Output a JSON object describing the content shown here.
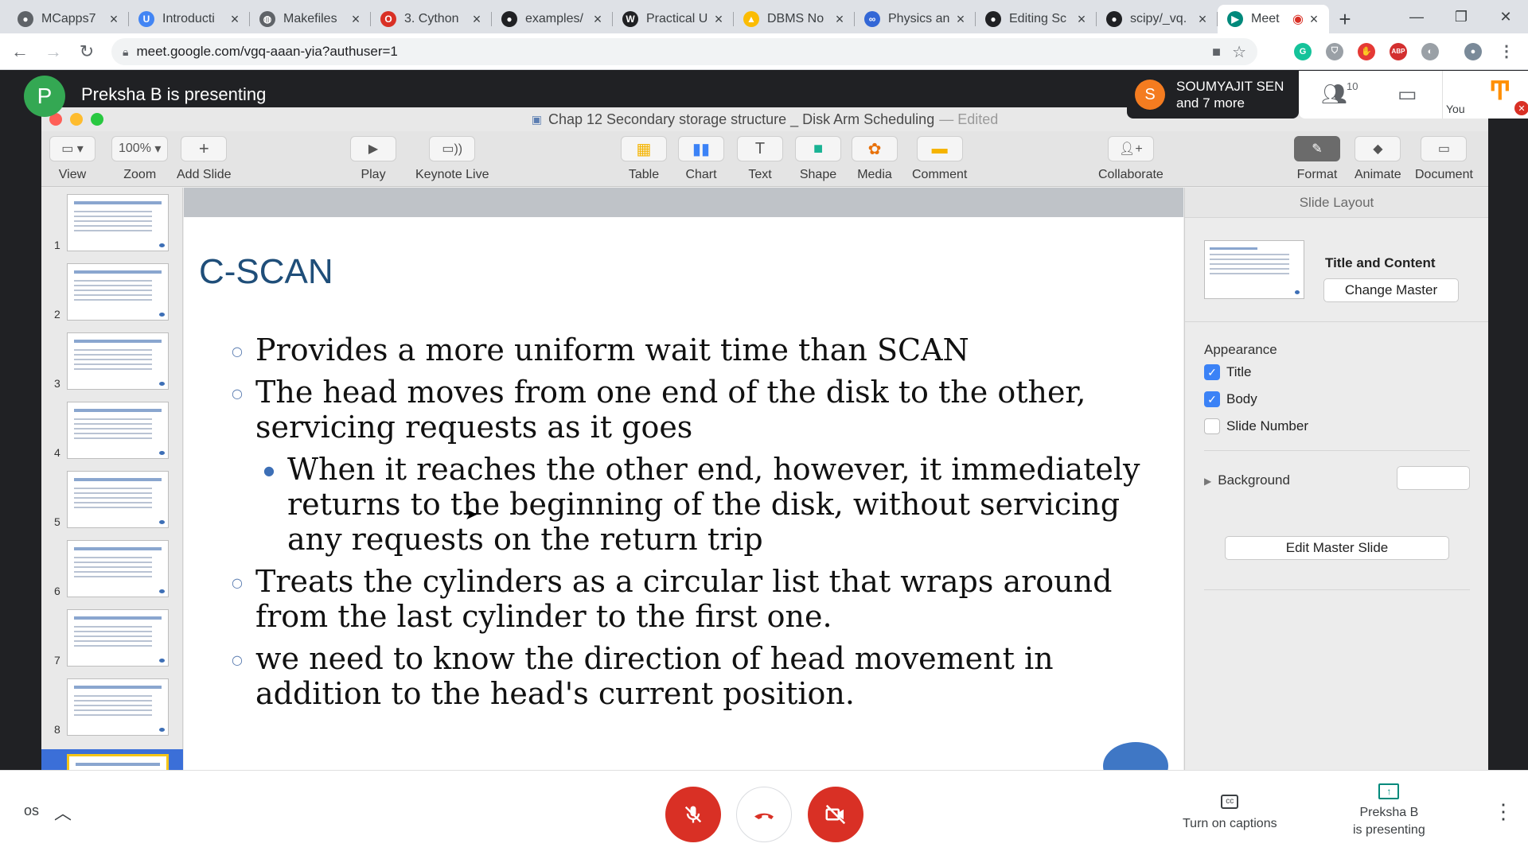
{
  "browser": {
    "tabs": [
      {
        "title": "MCapps7",
        "favicon_color": "#5f6368",
        "favicon": "github-icon"
      },
      {
        "title": "Introducti",
        "favicon_color": "#4285f4",
        "favicon": "u-icon"
      },
      {
        "title": "Makefiles",
        "favicon_color": "#5f6368",
        "favicon": "globe-icon"
      },
      {
        "title": "3. Cython",
        "favicon_color": "#d93025",
        "favicon": "o-icon"
      },
      {
        "title": "examples/",
        "favicon_color": "#202124",
        "favicon": "github-icon"
      },
      {
        "title": "Practical U",
        "favicon_color": "#202124",
        "favicon": "w-icon"
      },
      {
        "title": "DBMS No",
        "favicon_color": "#fbbc04",
        "favicon": "drive-icon"
      },
      {
        "title": "Physics an",
        "favicon_color": "#3367d6",
        "favicon": "infinity-icon"
      },
      {
        "title": "Editing Sc",
        "favicon_color": "#202124",
        "favicon": "github-icon"
      },
      {
        "title": "scipy/_vq.",
        "favicon_color": "#202124",
        "favicon": "github-icon"
      },
      {
        "title": "Meet",
        "favicon_color": "#00897b",
        "favicon": "meet-icon"
      }
    ],
    "new_tab": "+",
    "url": "meet.google.com/vgq-aaan-yia?authuser=1"
  },
  "meet": {
    "presenter_initial": "P",
    "presenting_label": "Preksha B is presenting",
    "participant_initial": "S",
    "participant_name": "SOUMYAJIT SEN",
    "participant_more": "and 7 more",
    "people_count": "10",
    "you_label": "You",
    "meeting_code": "os",
    "captions_label": "Turn on captions",
    "presenting_line1": "Preksha B",
    "presenting_line2": "is presenting"
  },
  "keynote": {
    "doc_title": "Chap 12 Secondary storage structure _ Disk Arm Scheduling",
    "doc_status": "— Edited",
    "toolbar": {
      "view": "View",
      "zoom_value": "100%",
      "zoom": "Zoom",
      "add_slide": "Add Slide",
      "play": "Play",
      "keynote_live": "Keynote Live",
      "table": "Table",
      "chart": "Chart",
      "text": "Text",
      "shape": "Shape",
      "media": "Media",
      "comment": "Comment",
      "collaborate": "Collaborate",
      "format": "Format",
      "animate": "Animate",
      "document": "Document"
    },
    "slide_numbers": [
      "1",
      "2",
      "3",
      "4",
      "5",
      "6",
      "7",
      "8"
    ],
    "slide": {
      "title": "C-SCAN",
      "bullet1": "Provides a more uniform wait time than SCAN",
      "bullet2_line1": "The head moves from one end of the disk to the other,",
      "bullet2_line2": "servicing requests as it goes",
      "sub_line1": "When it reaches the other end, however, it immediately",
      "sub_line2": "returns to the beginning of the disk, without servicing",
      "sub_line3": "any requests on the return trip",
      "bullet3_line1": "Treats the cylinders as a circular list that wraps around",
      "bullet3_line2": "from the last cylinder to the first one.",
      "bullet4_line1": "we need to know the direction of head movement in",
      "bullet4_line2": "addition to the head's current position."
    },
    "inspector": {
      "tab": "Slide Layout",
      "layout_name": "Title and Content",
      "change_master": "Change Master",
      "appearance": "Appearance",
      "title_opt": "Title",
      "body_opt": "Body",
      "slide_number_opt": "Slide Number",
      "background": "Background",
      "edit_master": "Edit Master Slide"
    }
  }
}
